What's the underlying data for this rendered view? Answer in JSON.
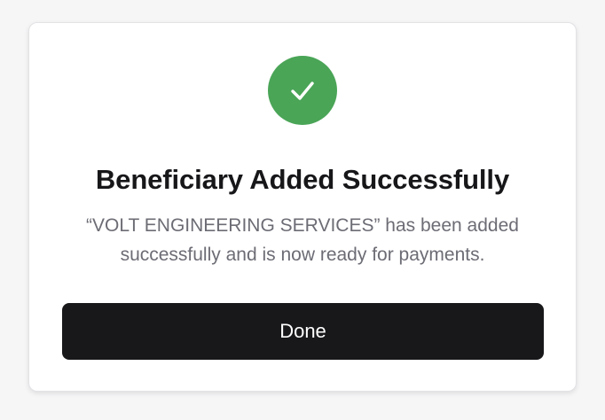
{
  "dialog": {
    "icon": "checkmark-icon",
    "icon_color": "#4aa557",
    "title": "Beneficiary Added Successfully",
    "message": "“VOLT ENGINEERING SERVICES” has been added successfully and is now ready for payments.",
    "done_label": "Done",
    "button_color": "#18181b"
  }
}
